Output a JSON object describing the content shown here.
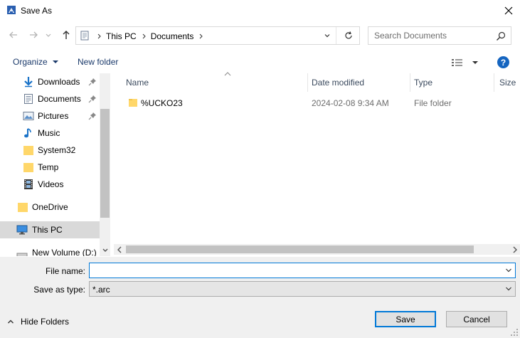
{
  "window": {
    "title": "Save As"
  },
  "address": {
    "crumbs": [
      "This PC",
      "Documents"
    ]
  },
  "search": {
    "placeholder": "Search Documents"
  },
  "toolbar": {
    "organize_label": "Organize",
    "new_folder_label": "New folder",
    "help_label": "?"
  },
  "nav_pane": {
    "items": [
      {
        "label": "Downloads",
        "icon": "download-arrow-icon",
        "pinned": true
      },
      {
        "label": "Documents",
        "icon": "document-icon",
        "pinned": true
      },
      {
        "label": "Pictures",
        "icon": "picture-icon",
        "pinned": true
      },
      {
        "label": "Music",
        "icon": "music-note-icon"
      },
      {
        "label": "System32",
        "icon": "folder-icon"
      },
      {
        "label": "Temp",
        "icon": "folder-icon"
      },
      {
        "label": "Videos",
        "icon": "film-icon"
      },
      {
        "label": "OneDrive",
        "icon": "folder-icon"
      },
      {
        "label": "This PC",
        "icon": "monitor-icon",
        "selected": true
      },
      {
        "label": "New Volume (D:)",
        "icon": "drive-icon"
      }
    ]
  },
  "columns": {
    "name": "Name",
    "date": "Date modified",
    "type": "Type",
    "size": "Size"
  },
  "files": [
    {
      "name": "%UCKO23",
      "date": "2024-02-08 9:34 AM",
      "type": "File folder"
    }
  ],
  "form": {
    "filename_label": "File name:",
    "filename_value": "",
    "save_type_label": "Save as type:",
    "save_type_value": "*.arc"
  },
  "footer": {
    "hide_folders_label": "Hide Folders",
    "save_label": "Save",
    "cancel_label": "Cancel"
  },
  "colors": {
    "accent": "#0078d7",
    "folder": "#ffd76a",
    "help": "#1565c0",
    "link": "#1b3a6b"
  }
}
